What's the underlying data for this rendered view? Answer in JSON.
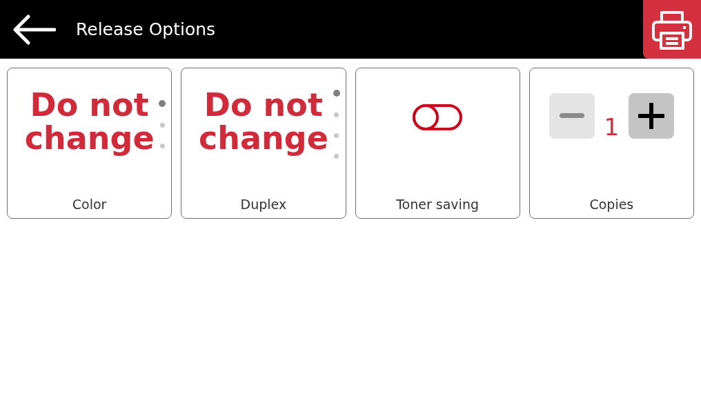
{
  "header": {
    "title": "Release Options"
  },
  "tiles": [
    {
      "kind": "choice",
      "label": "Color",
      "value": "Do not change",
      "pages": [
        {
          "selected": true
        },
        {
          "selected": false
        },
        {
          "selected": false
        }
      ]
    },
    {
      "kind": "choice",
      "label": "Duplex",
      "value": "Do not change",
      "pages": [
        {
          "selected": true
        },
        {
          "selected": false
        },
        {
          "selected": false
        },
        {
          "selected": false
        }
      ]
    },
    {
      "kind": "toggle",
      "label": "Toner saving",
      "on": false
    },
    {
      "kind": "counter",
      "label": "Copies",
      "value": "1",
      "minus_disabled": true,
      "plus_disabled": false
    }
  ]
}
